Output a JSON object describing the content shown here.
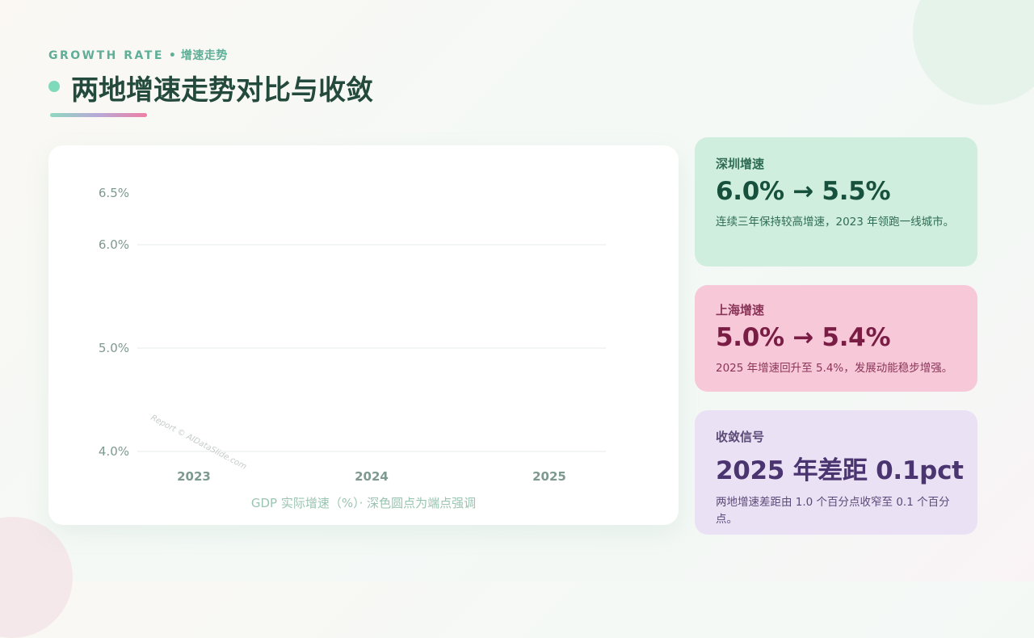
{
  "header": {
    "eyebrow_en": "GROWTH RATE",
    "eyebrow_sep": "•",
    "eyebrow_cn": "增速走势",
    "title": "两地增速走势对比与收敛"
  },
  "chart_data": {
    "type": "line",
    "x": [
      "2023",
      "2024",
      "2025"
    ],
    "y_ticks": [
      "6.5%",
      "6.0%",
      "5.0%",
      "4.0%"
    ],
    "ylim": [
      4.0,
      6.5
    ],
    "grid": true,
    "caption": "GDP 实际增速（%）· 深色圆点为端点强调",
    "watermark": "Report © AIDataSlide.com"
  },
  "cards": [
    {
      "label": "深圳增速",
      "value": "6.0% → 5.5%",
      "desc": "连续三年保持较高增速，2023 年领跑一线城市。",
      "bg": "#cfeedd"
    },
    {
      "label": "上海增速",
      "value": "5.0% → 5.4%",
      "desc": "2025 年增速回升至 5.4%，发展动能稳步增强。",
      "bg": "#f7c8d8"
    },
    {
      "label": "收敛信号",
      "value": "2025 年差距 0.1pct",
      "desc": "两地增速差距由 1.0 个百分点收窄至 0.1 个百分点。",
      "bg": "#ebe1f4"
    }
  ]
}
